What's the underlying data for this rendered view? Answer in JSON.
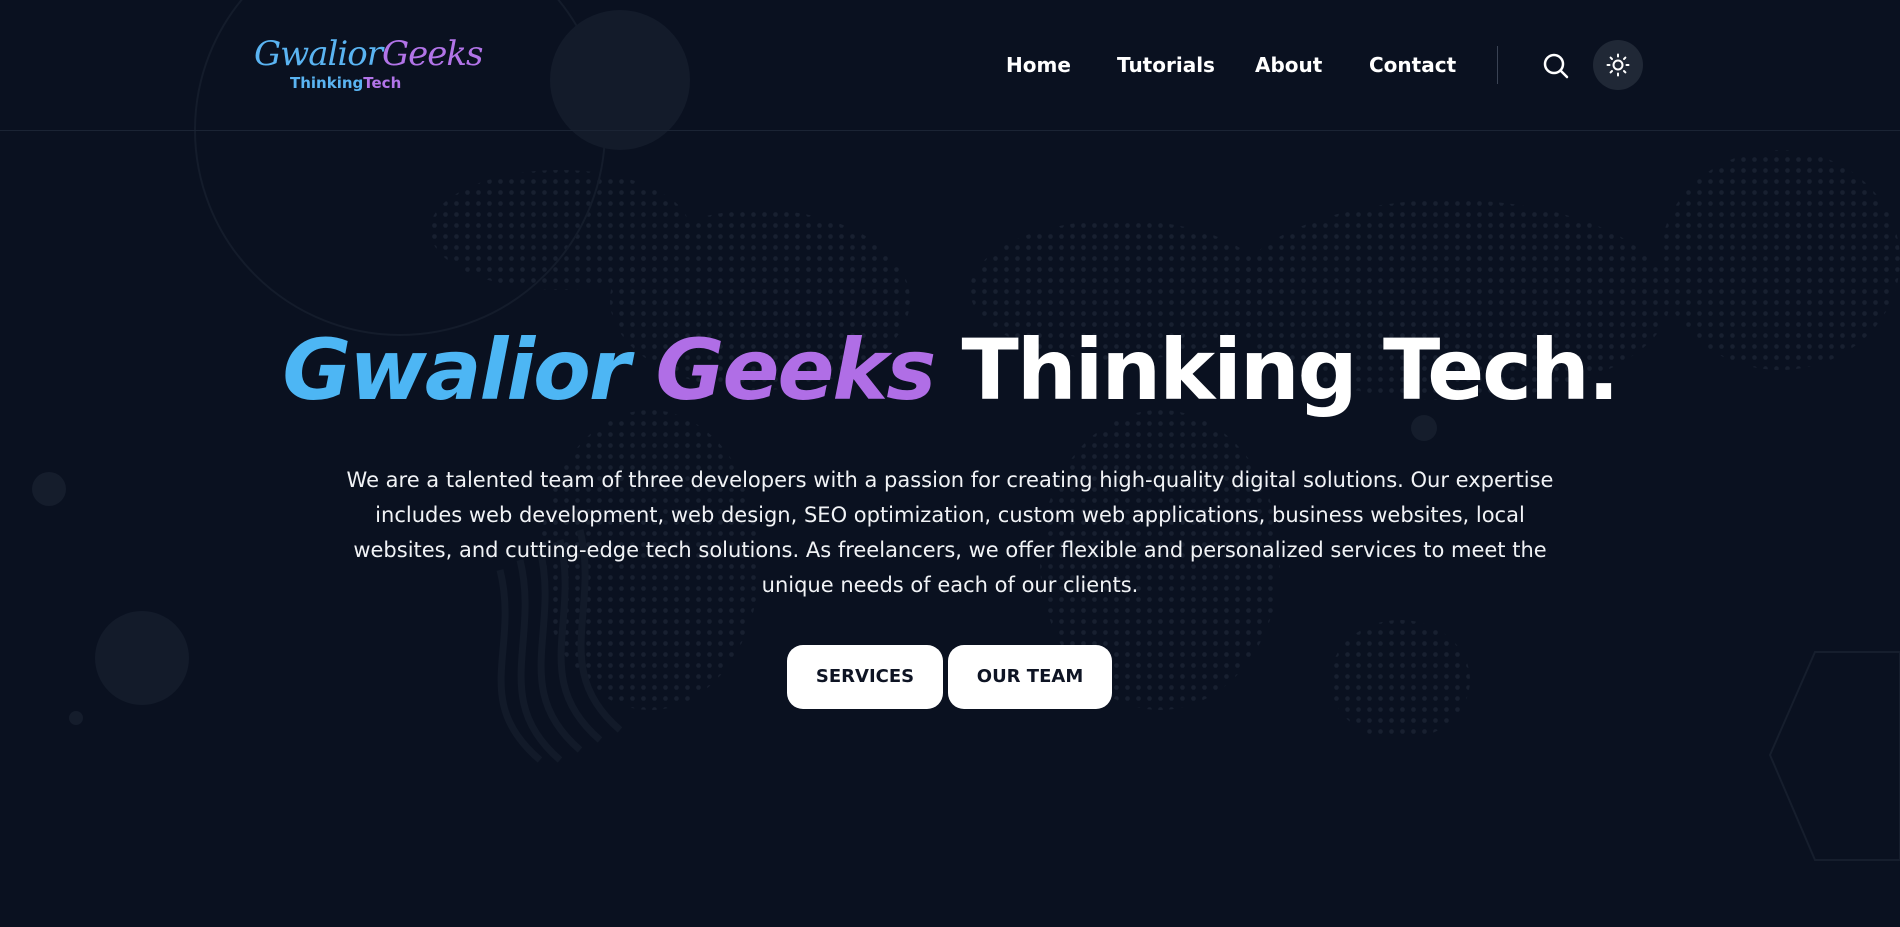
{
  "header": {
    "logo": {
      "word1": "Gwalior",
      "word2": "Geeks",
      "sub1": "Thinking",
      "sub2": "Tech"
    },
    "nav": [
      {
        "label": "Home"
      },
      {
        "label": "Tutorials"
      },
      {
        "label": "About"
      },
      {
        "label": "Contact"
      }
    ],
    "search_icon": "search-icon",
    "theme_toggle_icon": "sun-icon"
  },
  "hero": {
    "title_part1": "Gwalior",
    "title_part2": "Geeks",
    "title_part3": "Thinking Tech.",
    "description": "We are a talented team of three developers with a passion for creating high-quality digital solutions. Our expertise includes web development, web design, SEO optimization, custom web applications, business websites, local websites, and cutting-edge tech solutions. As freelancers, we offer flexible and personalized services to meet the unique needs of each of our clients.",
    "buttons": [
      {
        "label": "SERVICES"
      },
      {
        "label": "OUR TEAM"
      }
    ]
  },
  "colors": {
    "background": "#0a1120",
    "accent_blue": "#4db6f4",
    "accent_purple": "#b06ee6",
    "text": "#ffffff",
    "button_bg": "#ffffff",
    "button_text": "#0e1424"
  }
}
